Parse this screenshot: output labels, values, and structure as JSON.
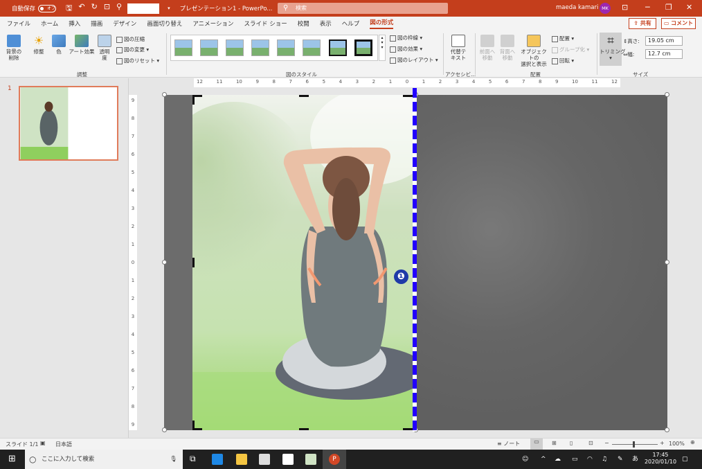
{
  "titlebar": {
    "autosave_label": "自動保存",
    "autosave_state": "オフ",
    "doc_title": "プレゼンテーション1 - PowerPo...",
    "search_placeholder": "検索",
    "user_name": "maeda kamari",
    "user_initials": "MK"
  },
  "menu": {
    "tabs": [
      "ファイル",
      "ホーム",
      "挿入",
      "描画",
      "デザイン",
      "画面切り替え",
      "アニメーション",
      "スライド ショー",
      "校閲",
      "表示",
      "ヘルプ",
      "図の形式"
    ],
    "share_label": "共有",
    "comment_label": "コメント"
  },
  "ribbon": {
    "remove_bg": "背景の\n削除",
    "corrections": "修整",
    "color": "色",
    "art_effects": "アート効果",
    "transparency": "透明\n度",
    "compress": "図の圧縮",
    "change": "図の変更",
    "reset": "図のリセット",
    "group_adjust": "調整",
    "group_styles": "図のスタイル",
    "border": "図の枠線",
    "effects": "図の効果",
    "layout": "図のレイアウト",
    "alt_text": "代替テ\nキスト",
    "group_access": "アクセシビ...",
    "bring_forward": "前面へ\n移動",
    "send_backward": "背面へ\n移動",
    "selection_pane": "オブジェクトの\n選択と表示",
    "align": "配置",
    "group": "グループ化",
    "rotate": "回転",
    "group_arrange": "配置",
    "crop": "トリミング",
    "height_label": "高さ:",
    "height_value": "19.05 cm",
    "width_label": "幅:",
    "width_value": "12.7 cm",
    "group_size": "サイズ"
  },
  "slides": {
    "number": "1"
  },
  "ruler": {
    "h_labels": [
      "12",
      "11",
      "10",
      "9",
      "8",
      "7",
      "6",
      "5",
      "4",
      "3",
      "2",
      "1",
      "0",
      "1",
      "2",
      "3",
      "4",
      "5",
      "6",
      "7",
      "8",
      "9",
      "10",
      "11",
      "12"
    ],
    "v_labels": [
      "9",
      "8",
      "7",
      "6",
      "5",
      "4",
      "3",
      "2",
      "1",
      "0",
      "1",
      "2",
      "3",
      "4",
      "5",
      "6",
      "7",
      "8",
      "9"
    ]
  },
  "annotation": {
    "marker": "❶"
  },
  "statusbar": {
    "slide_info": "スライド 1/1",
    "language": "日本語",
    "notes": "ノート",
    "zoom": "100%"
  },
  "taskbar": {
    "search_placeholder": "ここに入力して検索",
    "time": "17:45",
    "date": "2020/01/10",
    "ime": "あ"
  },
  "colors": {
    "accent": "#c43e1c",
    "crop_line": "#2200ff",
    "marker_bg": "#1f3aa8"
  }
}
